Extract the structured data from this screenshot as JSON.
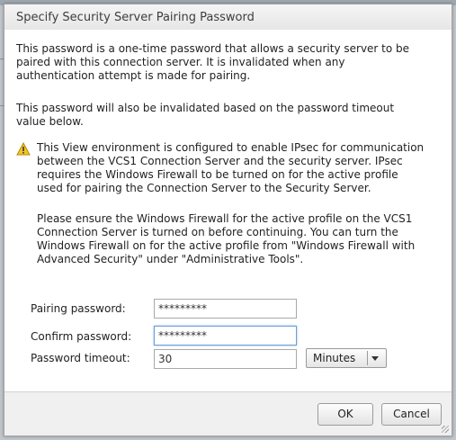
{
  "dialog": {
    "title": "Specify Security Server Pairing Password",
    "paragraph1": "This password is a one-time password that allows a security server to be\npaired with this connection server. It is invalidated when any\nauthentication attempt is made for pairing.",
    "paragraph2": "This password will also be invalidated based on the password timeout\nvalue below.",
    "warning1": "This View environment is configured to enable IPsec for communication\nbetween the VCS1 Connection Server and the security server. IPsec\nrequires the Windows Firewall to be turned on for the active profile\nused for pairing the Connection Server to the Security Server.",
    "warning2": "Please ensure the Windows Firewall for the active profile on the VCS1\nConnection Server is turned on before continuing. You can turn the\nWindows Firewall on for the active profile from \"Windows Firewall with\nAdvanced Security\" under \"Administrative Tools\"."
  },
  "form": {
    "pairing_label": "Pairing password:",
    "pairing_value": "*********",
    "confirm_label": "Confirm password:",
    "confirm_value": "*********",
    "timeout_label": "Password timeout:",
    "timeout_value": "30",
    "timeout_unit": "Minutes"
  },
  "buttons": {
    "ok": "OK",
    "cancel": "Cancel"
  },
  "icons": {
    "warning": "warning-icon",
    "dropdown": "chevron-down-icon"
  },
  "colors": {
    "warning_fill": "#f3c623",
    "focus_border": "#6aa0d8"
  }
}
